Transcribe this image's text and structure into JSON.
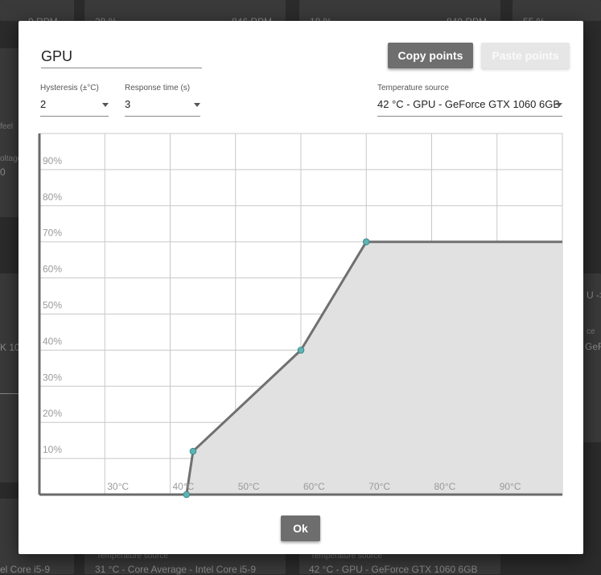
{
  "background": {
    "fragments": [
      "0 RPM",
      "28 %",
      "846 RPM",
      "18 %",
      "849 RPM",
      "55 %",
      "feel",
      "oltage",
      "0",
      "U ->",
      "ce",
      "GeF",
      "K 10",
      "Temperature source",
      "31 °C - Core Average - Intel Core i5-9",
      "Temperature source",
      "42 °C - GPU - GeForce GTX 1060 6GB",
      "el Core i5-9"
    ]
  },
  "dialog": {
    "name_value": "GPU",
    "copy_label": "Copy points",
    "paste_label": "Paste points",
    "ok_label": "Ok",
    "hysteresis": {
      "label": "Hysteresis (±°C)",
      "value": "2"
    },
    "response": {
      "label": "Response time (s)",
      "value": "3"
    },
    "source": {
      "label": "Temperature source",
      "value": "42 °C - GPU - GeForce GTX 1060 6GB"
    }
  },
  "colors": {
    "grid": "#c8c8c8",
    "axis": "#6a6a6a",
    "curve": "#707070",
    "fill": "#e1e1e1",
    "point_fill": "#5fb3b3",
    "point_stroke": "#3a8a8a",
    "label": "#9a9a9a"
  },
  "chart_data": {
    "type": "line",
    "xlim": [
      20,
      100
    ],
    "ylim": [
      0,
      100
    ],
    "x_ticks": [
      30,
      40,
      50,
      60,
      70,
      80,
      90
    ],
    "x_tick_labels": [
      "30°C",
      "40°C",
      "50°C",
      "60°C",
      "70°C",
      "80°C",
      "90°C"
    ],
    "y_ticks": [
      10,
      20,
      30,
      40,
      50,
      60,
      70,
      80,
      90
    ],
    "y_tick_labels": [
      "10%",
      "20%",
      "30%",
      "40%",
      "50%",
      "60%",
      "70%",
      "80%",
      "90%"
    ],
    "grid": true,
    "series": [
      {
        "x": [
          20,
          42.5,
          43.5,
          60,
          70,
          100
        ],
        "y": [
          0,
          0,
          12,
          40,
          70,
          70
        ]
      }
    ],
    "control_points": [
      {
        "x": 42.5,
        "y": 0
      },
      {
        "x": 43.5,
        "y": 12
      },
      {
        "x": 60,
        "y": 40
      },
      {
        "x": 70,
        "y": 70
      }
    ]
  }
}
